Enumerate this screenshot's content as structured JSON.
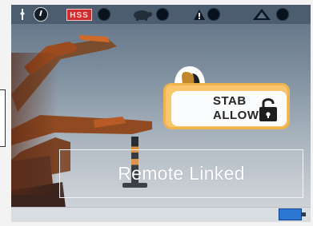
{
  "topbar": {
    "indicators": [
      {
        "name": "wrench-icon"
      },
      {
        "name": "clock-icon"
      },
      {
        "label": "HSS",
        "name": "hss-indicator"
      },
      {
        "name": "status-circle"
      },
      {
        "name": "turtle-icon"
      },
      {
        "name": "status-circle"
      },
      {
        "name": "warning-icon"
      },
      {
        "name": "status-circle"
      },
      {
        "name": "triangle-warning-icon"
      },
      {
        "name": "status-circle"
      }
    ]
  },
  "stab_panel": {
    "label_line1": "STAB",
    "label_line2": "ALLOW"
  },
  "remote_status": "Remote Linked",
  "colors": {
    "topbar_bg": "#4c5d70",
    "hss_red": "#cf2d2d",
    "accent_orange": "#f0b44d",
    "battery_blue": "#2a78d2"
  }
}
